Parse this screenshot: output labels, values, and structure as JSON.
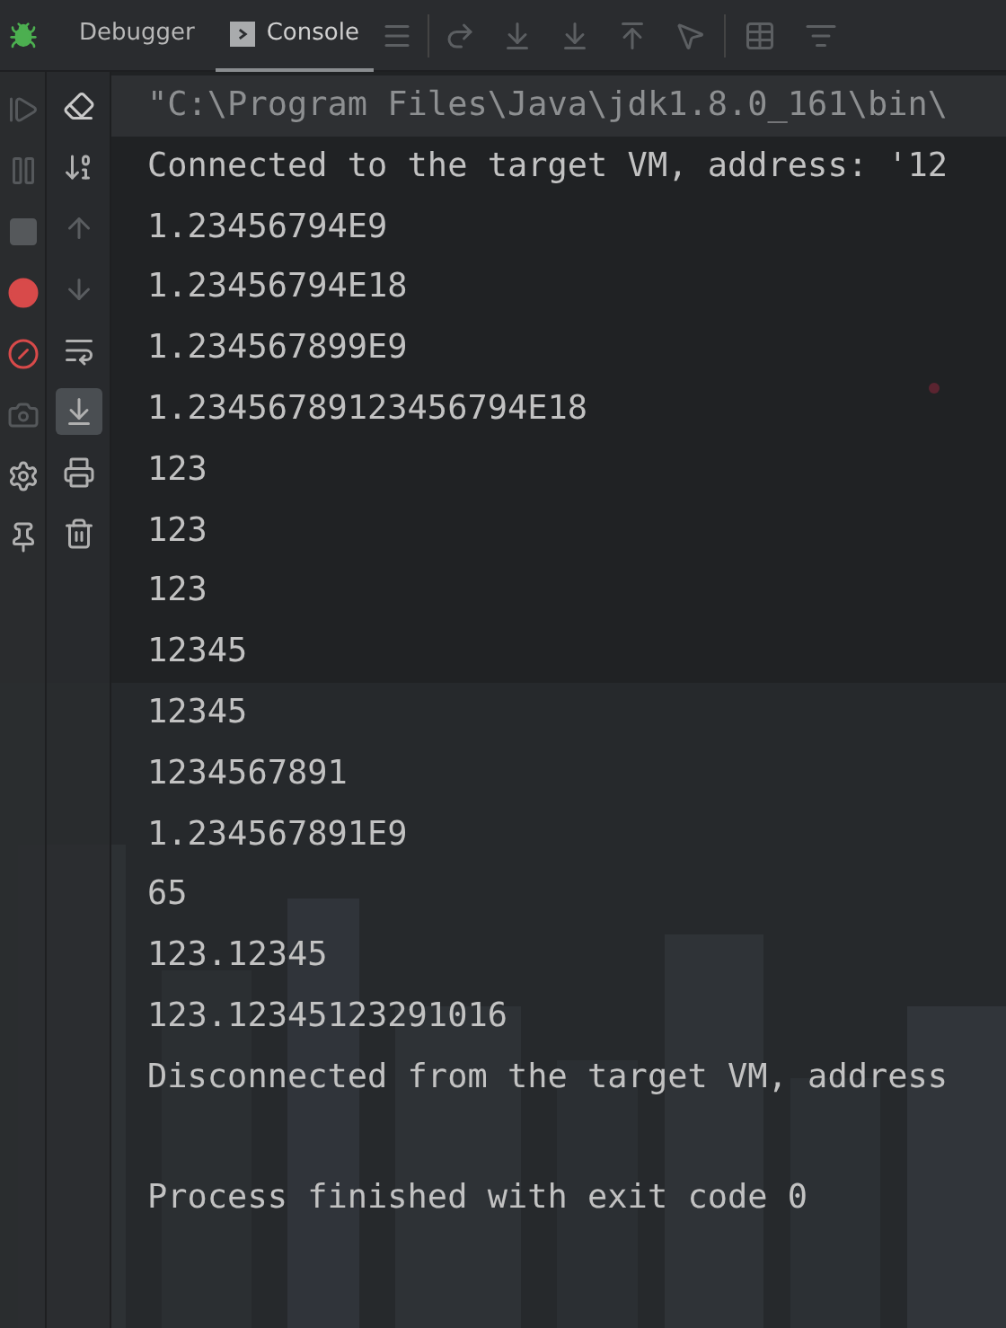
{
  "tabs": [
    {
      "label": "Debugger",
      "selected": false
    },
    {
      "label": "Console",
      "selected": true
    }
  ],
  "console_tools": [
    {
      "kind": "clear",
      "selected": false
    },
    {
      "kind": "sort",
      "selected": false
    },
    {
      "kind": "up",
      "selected": false
    },
    {
      "kind": "down",
      "selected": false
    },
    {
      "kind": "wrap",
      "selected": false
    },
    {
      "kind": "scroll-end",
      "selected": true
    },
    {
      "kind": "print",
      "selected": false
    },
    {
      "kind": "trash",
      "selected": false
    }
  ],
  "console_lines": [
    {
      "kind": "command",
      "text": "\"C:\\Program Files\\Java\\jdk1.8.0_161\\bin\\"
    },
    {
      "kind": "output",
      "text": "Connected to the target VM, address: '12"
    },
    {
      "kind": "output",
      "text": "1.23456794E9"
    },
    {
      "kind": "output",
      "text": "1.23456794E18"
    },
    {
      "kind": "output",
      "text": "1.234567899E9"
    },
    {
      "kind": "output",
      "text": "1.23456789123456794E18"
    },
    {
      "kind": "output",
      "text": "123"
    },
    {
      "kind": "output",
      "text": "123"
    },
    {
      "kind": "output",
      "text": "123"
    },
    {
      "kind": "output",
      "text": "12345"
    },
    {
      "kind": "output",
      "text": "12345"
    },
    {
      "kind": "output",
      "text": "1234567891"
    },
    {
      "kind": "output",
      "text": "1.234567891E9"
    },
    {
      "kind": "output",
      "text": "65"
    },
    {
      "kind": "output",
      "text": "123.12345"
    },
    {
      "kind": "output",
      "text": "123.12345123291016"
    },
    {
      "kind": "output",
      "text": "Disconnected from the target VM, address"
    },
    {
      "kind": "blank"
    },
    {
      "kind": "output",
      "text": "Process finished with exit code 0"
    }
  ]
}
